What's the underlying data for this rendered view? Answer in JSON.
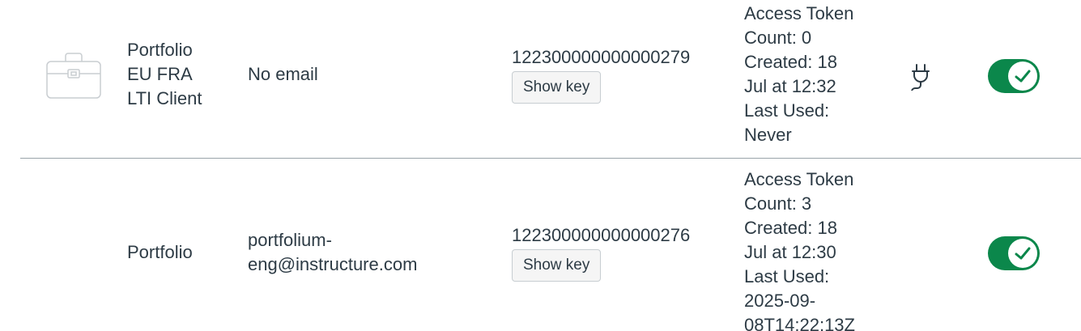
{
  "colors": {
    "toggle_on": "#0b874b",
    "text": "#2d3b45",
    "divider": "#9aa3a9"
  },
  "rows": [
    {
      "logo_icon": "briefcase-icon",
      "name_lines": [
        "Portfolio",
        "EU FRA",
        "LTI Client"
      ],
      "email": "No email",
      "client_id": "122300000000000279",
      "show_key_label": "Show key",
      "details": [
        "Access Token",
        "Count: 0",
        "Created: 18",
        "Jul at 12:32",
        "Last Used:",
        "Never"
      ],
      "type_icon": "plug-icon",
      "enabled": true
    },
    {
      "name_lines": [
        "Portfolio"
      ],
      "email_lines": [
        "portfolium-",
        "eng@instructure.com"
      ],
      "client_id": "122300000000000276",
      "show_key_label": "Show key",
      "details": [
        "Access Token",
        "Count: 3",
        "Created: 18",
        "Jul at 12:30",
        "Last Used:",
        "2025-09-",
        "08T14:22:13Z"
      ],
      "enabled": true
    }
  ]
}
